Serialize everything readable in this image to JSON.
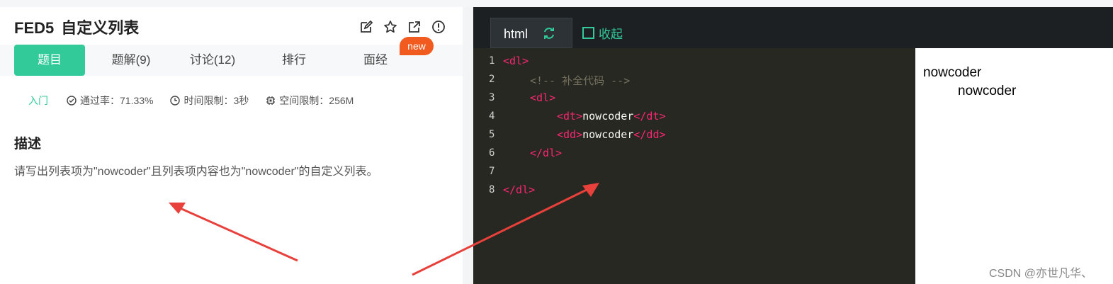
{
  "problem": {
    "code": "FED5",
    "title": "自定义列表",
    "new_badge": "new"
  },
  "tabs": [
    "题目",
    "题解(9)",
    "讨论(12)",
    "排行",
    "面经"
  ],
  "meta": {
    "level": "入门",
    "pass_rate": "通过率：71.33%",
    "time_limit": "时间限制：3秒",
    "space_limit": "空间限制：256M"
  },
  "description": {
    "heading": "描述",
    "text": "请写出列表项为\"nowcoder\"且列表项内容也为\"nowcoder\"的自定义列表。"
  },
  "editor": {
    "tab_label": "html",
    "collapse_label": "收起",
    "line_numbers": [
      "1",
      "2",
      "3",
      "4",
      "5",
      "6",
      "7",
      "8"
    ],
    "code": {
      "l1_tag": "<dl>",
      "l2_comment": "<!-- 补全代码 -->",
      "l3_tag": "<dl>",
      "l4_open": "<dt>",
      "l4_text": "nowcoder",
      "l4_close": "</dt>",
      "l5_open": "<dd>",
      "l5_text": "nowcoder",
      "l5_close": "</dd>",
      "l6_tag": "</dl>",
      "l8_tag": "</dl>"
    }
  },
  "preview": {
    "dt": "nowcoder",
    "dd": "nowcoder"
  },
  "watermark": "CSDN @亦世凡华、",
  "colors": {
    "accent": "#32ca99",
    "badge": "#f25b1f",
    "editor_bg": "#272822",
    "tag": "#f92672",
    "arrow": "#e8403b"
  }
}
